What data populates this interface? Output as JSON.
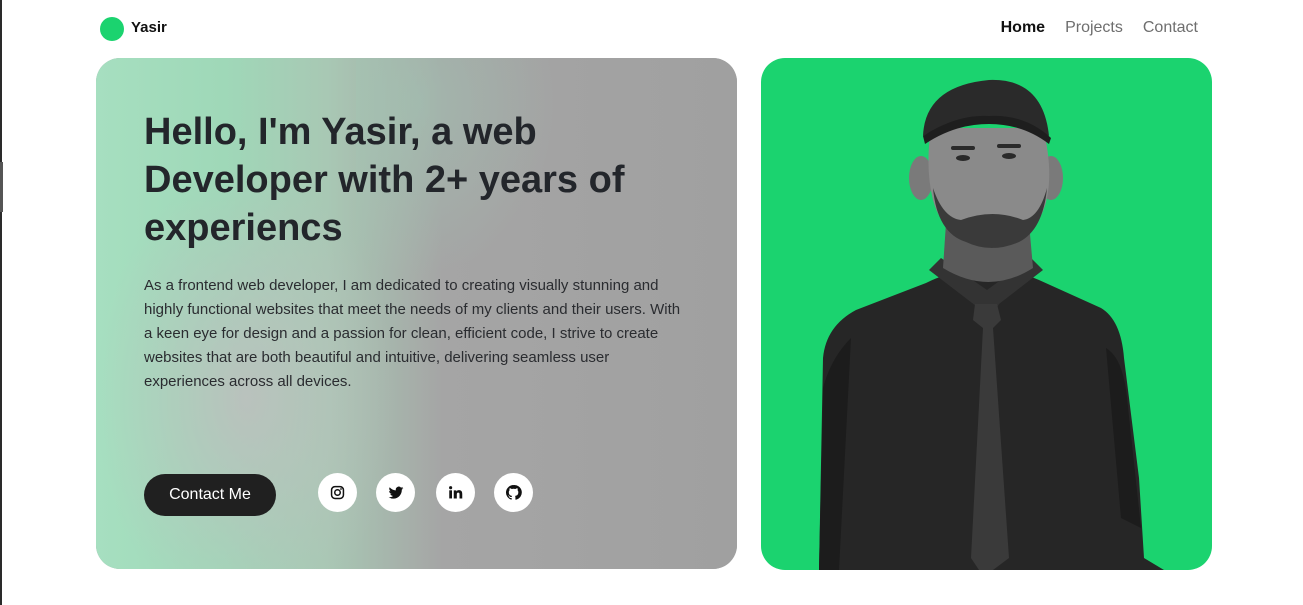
{
  "brand": {
    "name": "Yasir",
    "accent_color": "#1bd36f"
  },
  "nav": {
    "items": [
      {
        "label": "Home",
        "active": true
      },
      {
        "label": "Projects",
        "active": false
      },
      {
        "label": "Contact",
        "active": false
      }
    ]
  },
  "hero": {
    "title": "Hello, I'm Yasir, a web Developer with 2+ years of experiencs",
    "description": "As a frontend web developer, I am dedicated to creating visually stunning and highly functional websites that meet the needs of my clients and their users. With a keen eye for design and a passion for clean, efficient code, I strive to create websites that are both beautiful and intuitive, delivering seamless user experiences across all devices.",
    "cta_label": "Contact Me",
    "socials": [
      {
        "icon": "instagram-icon"
      },
      {
        "icon": "twitter-icon"
      },
      {
        "icon": "linkedin-icon"
      },
      {
        "icon": "github-icon"
      }
    ]
  },
  "photo": {
    "subject": "portrait-photo",
    "background_color": "#1bd36f"
  }
}
